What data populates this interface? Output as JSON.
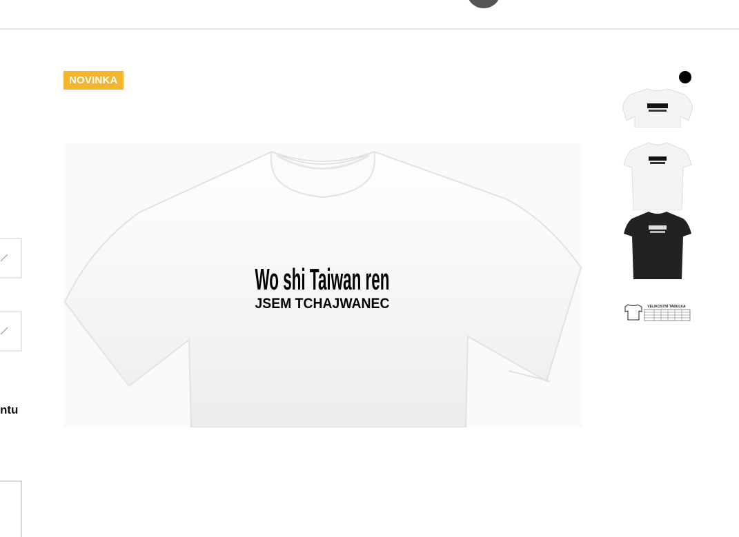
{
  "header": {
    "avatar": "user-avatar"
  },
  "product": {
    "badge": "NOVINKA",
    "print_line1": "Wo shi Taiwan ren",
    "print_line2": "JSEM TCHAJWANEC",
    "colors": {
      "badge": "#f5b52e",
      "shirt_light": "#f7f7f7",
      "shirt_dark": "#222222"
    }
  },
  "left_panel": {
    "label": "ntu"
  },
  "thumbnails": [
    {
      "shirt": "white",
      "label": "thumbnail-white-front"
    },
    {
      "shirt": "white",
      "label": "thumbnail-white-full"
    },
    {
      "shirt": "black",
      "label": "thumbnail-black-full"
    },
    {
      "title": "VELIKOSTNÍ TABULKA"
    }
  ]
}
